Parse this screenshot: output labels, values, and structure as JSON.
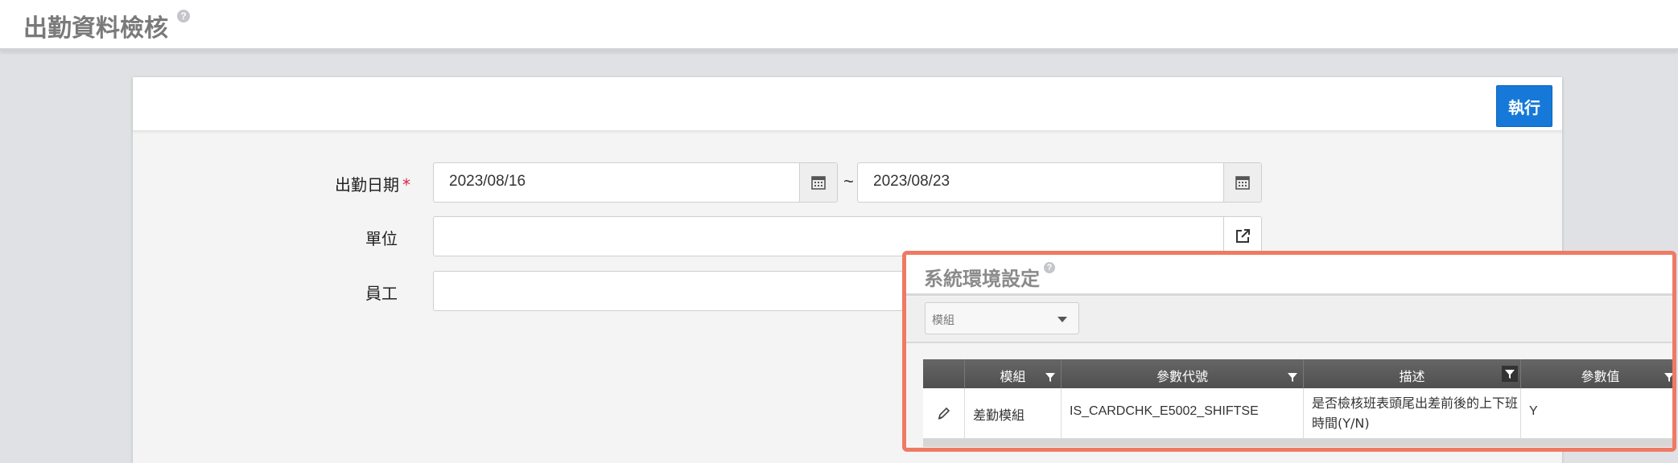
{
  "header": {
    "title": "出勤資料檢核",
    "help": "?"
  },
  "toolbar": {
    "run_label": "執行"
  },
  "form": {
    "date_label": "出勤日期",
    "required_mark": "*",
    "date_from": "2023/08/16",
    "date_to": "2023/08/23",
    "range_sep": "~",
    "unit_label": "單位",
    "unit_value": "",
    "employee_label": "員工",
    "employee_value": ""
  },
  "overlay": {
    "title": "系統環境設定",
    "help": "?",
    "module_select_placeholder": "模組",
    "columns": [
      "模組",
      "參數代號",
      "描述",
      "參數值"
    ],
    "rows": [
      {
        "module": "差勤模組",
        "param_code": "IS_CARDCHK_E5002_SHIFTSE",
        "description": "是否檢核班表頭尾出差前後的上下班時間(Y/N)",
        "value": "Y"
      }
    ]
  },
  "icons": {
    "calendar": "calendar-icon",
    "open_picker": "external-link-icon",
    "filter": "filter-icon",
    "edit": "pencil-icon",
    "dropdown": "chevron-down-icon"
  },
  "colors": {
    "primary_button": "#1679d9",
    "highlight_border": "#ef7a63",
    "required": "#d9234b",
    "grid_header": "#555555"
  }
}
